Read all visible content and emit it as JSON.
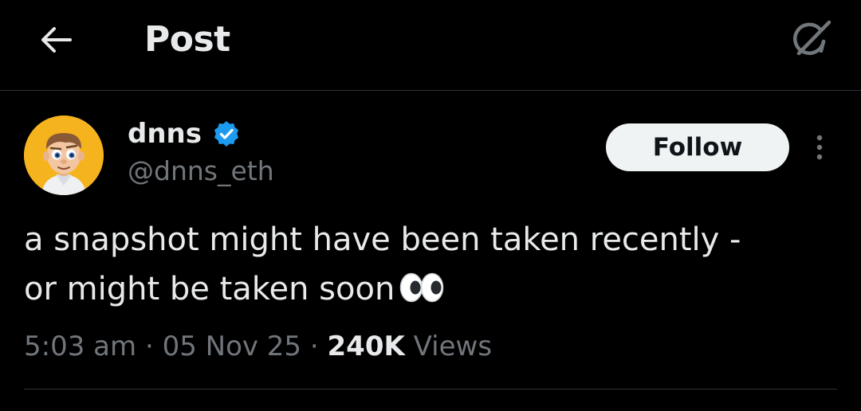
{
  "header": {
    "title": "Post",
    "back_icon": "arrow-left-icon",
    "grok_icon": "grok-icon"
  },
  "post": {
    "author": {
      "display_name": "dnns",
      "handle": "@dnns_eth",
      "verified": true,
      "verified_color": "#1d9bf0",
      "avatar_bg": "#f5b41e"
    },
    "follow_label": "Follow",
    "more_icon": "more-vertical-icon",
    "text_line1": "a snapshot might have been taken recently -",
    "text_line2": "or might be taken soon",
    "emoji": "eyes-emoji",
    "time": "5:03 am",
    "separator": "·",
    "date": "05 Nov 25",
    "views_count": "240K",
    "views_label": "Views"
  },
  "colors": {
    "background": "#000000",
    "text_primary": "#e7e9ea",
    "text_secondary": "#71767b",
    "divider": "#2f3336"
  }
}
